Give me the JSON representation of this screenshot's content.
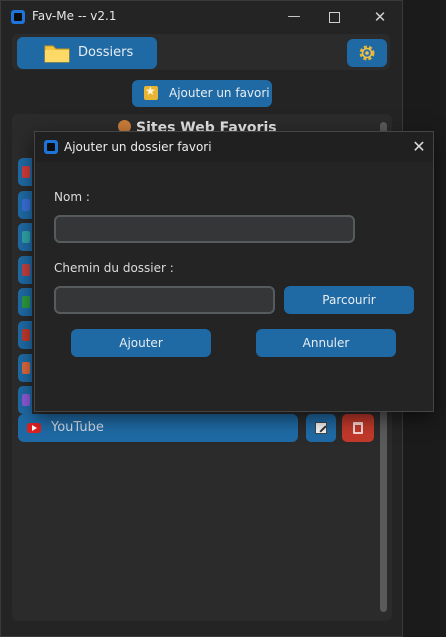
{
  "window": {
    "title": "Fav-Me -- v2.1",
    "minimize": "—",
    "close": "✕"
  },
  "toolbar": {
    "folders_label": "Dossiers",
    "add_favorite_label": "Ajouter un favori"
  },
  "panel": {
    "title": "Sites Web Favoris",
    "item": {
      "label": "YouTube"
    },
    "row_icon_colors": [
      "#d33b3b",
      "#3a6fd8",
      "#2fa3a8",
      "#c04040",
      "#2c9a3c",
      "#c0392b",
      "#d9683a",
      "#8a5ad6"
    ]
  },
  "dialog": {
    "title": "Ajouter un dossier favori",
    "close": "✕",
    "name_label": "Nom :",
    "name_value": "",
    "path_label": "Chemin du dossier :",
    "path_value": "",
    "browse_label": "Parcourir",
    "add_label": "Ajouter",
    "cancel_label": "Annuler"
  },
  "colors": {
    "accent": "#1f6aa5",
    "danger": "#c0392b",
    "background": "#242424"
  }
}
